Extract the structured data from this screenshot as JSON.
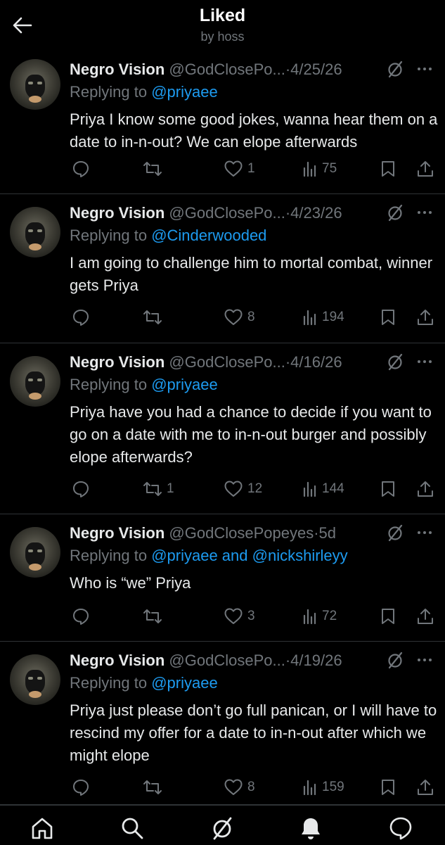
{
  "header": {
    "title": "Liked",
    "subtitle": "by hoss"
  },
  "posts": [
    {
      "name": "Negro Vision",
      "handle": "@GodClosePo...",
      "date": "4/25/26",
      "reply_prefix": "Replying to",
      "reply_to": "@priyaee",
      "text": "Priya I know some good jokes, wanna hear them on a date to in-n-out? We can elope afterwards",
      "replies": "",
      "reposts": "",
      "likes": "1",
      "views": "75"
    },
    {
      "name": "Negro Vision",
      "handle": "@GodClosePo...",
      "date": "4/23/26",
      "reply_prefix": "Replying to",
      "reply_to": "@Cinderwooded",
      "text": "I am going to challenge him to mortal combat, winner gets Priya",
      "replies": "",
      "reposts": "",
      "likes": "8",
      "views": "194"
    },
    {
      "name": "Negro Vision",
      "handle": "@GodClosePo...",
      "date": "4/16/26",
      "reply_prefix": "Replying to",
      "reply_to": "@priyaee",
      "text": "Priya have you had a chance to decide if you want to go on a date with me to in-n-out burger and possibly elope afterwards?",
      "replies": "",
      "reposts": "1",
      "likes": "12",
      "views": "144"
    },
    {
      "name": "Negro Vision",
      "handle": "@GodClosePopeyes",
      "date": "5d",
      "reply_prefix": "Replying to",
      "reply_to": "@priyaee and @nickshirleyy",
      "text": "Who is “we” Priya",
      "replies": "",
      "reposts": "",
      "likes": "3",
      "views": "72"
    },
    {
      "name": "Negro Vision",
      "handle": "@GodClosePo...",
      "date": "4/19/26",
      "reply_prefix": "Replying to",
      "reply_to": "@priyaee",
      "text": "Priya just please don’t go full panican, or I will have to rescind my offer for a date to in-n-out after which we might elope",
      "replies": "",
      "reposts": "",
      "likes": "8",
      "views": "159"
    }
  ],
  "nav": {
    "icons": [
      "home-icon",
      "search-icon",
      "grok-icon",
      "notifications-icon",
      "messages-icon"
    ]
  },
  "colors": {
    "background": "#000000",
    "text": "#e7e9ea",
    "muted": "#71767b",
    "accent": "#1d9bf0",
    "divider": "#2f3336"
  }
}
